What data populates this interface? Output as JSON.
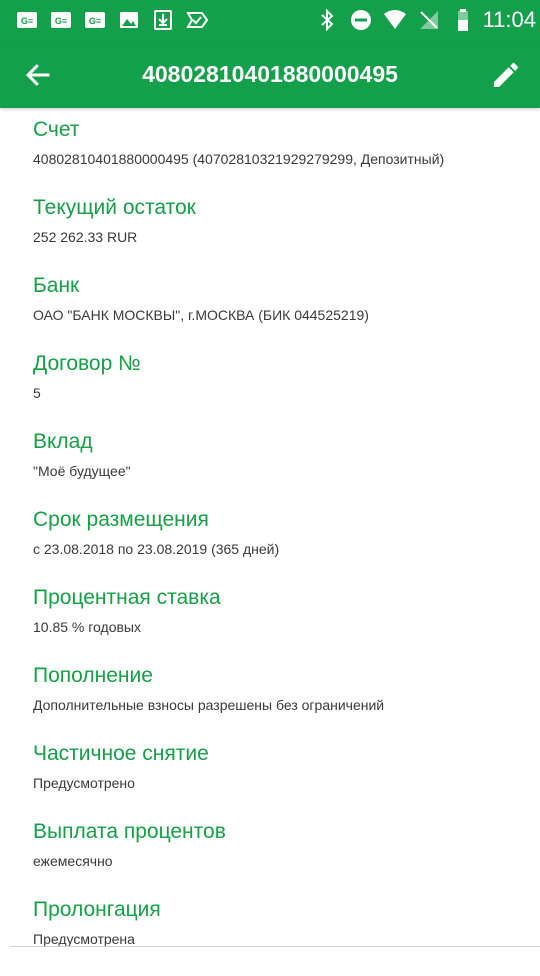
{
  "status_bar": {
    "time": "11:04",
    "left_icons": [
      "ge-money-icon",
      "ge-money-icon",
      "ge-money-icon",
      "image-icon",
      "download-icon",
      "check-label-icon"
    ],
    "right_icons": [
      "bluetooth-icon",
      "do-not-disturb-icon",
      "wifi-icon",
      "no-sim-icon",
      "battery-icon"
    ]
  },
  "app_bar": {
    "title": "40802810401880000495",
    "back_icon": "arrow-back-icon",
    "edit_icon": "pencil-icon"
  },
  "colors": {
    "primary": "#14a04a",
    "label": "#16a046",
    "value": "#3a3a3a"
  },
  "fields": [
    {
      "label": "Счет",
      "value": "40802810401880000495 (40702810321929279299, Депозитный)"
    },
    {
      "label": "Текущий остаток",
      "value": "252 262.33 RUR"
    },
    {
      "label": "Банк",
      "value": "ОАО \"БАНК МОСКВЫ\", г.МОСКВА (БИК 044525219)"
    },
    {
      "label": "Договор №",
      "value": "5"
    },
    {
      "label": "Вклад",
      "value": "\"Моё будущее\""
    },
    {
      "label": "Срок размещения",
      "value": "с 23.08.2018 по 23.08.2019 (365 дней)"
    },
    {
      "label": "Процентная ставка",
      "value": "10.85 % годовых"
    },
    {
      "label": "Пополнение",
      "value": "Дополнительные взносы разрешены без ограничений"
    },
    {
      "label": "Частичное снятие",
      "value": "Предусмотрено"
    },
    {
      "label": "Выплата процентов",
      "value": "ежемесячно"
    },
    {
      "label": "Пролонгация",
      "value": "Предусмотрена"
    }
  ]
}
